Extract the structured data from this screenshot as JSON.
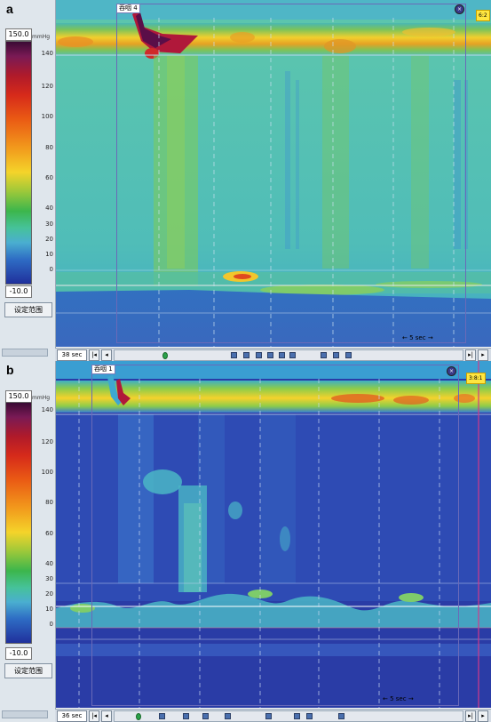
{
  "panels": [
    {
      "letter": "a",
      "scale": {
        "max": "150.0",
        "min": "-10.0",
        "unit": "mmHg",
        "ticks": [
          "140",
          "120",
          "100",
          "80",
          "60",
          "40",
          "30",
          "20",
          "10",
          "0"
        ]
      },
      "range_button": "设定范围",
      "record_label": "吞咽 4",
      "time_marker": "6:2",
      "scale_bar": "5 sec",
      "nav": {
        "interval": "38 sec",
        "events": 10
      }
    },
    {
      "letter": "b",
      "scale": {
        "max": "150.0",
        "min": "-10.0",
        "unit": "mmHg",
        "ticks": [
          "140",
          "120",
          "100",
          "80",
          "60",
          "40",
          "30",
          "20",
          "10",
          "0"
        ]
      },
      "range_button": "设定范围",
      "record_label": "吞咽 1",
      "time_marker": "3:8:1",
      "scale_bar": "5 sec",
      "nav": {
        "interval": "36 sec",
        "events": 9
      }
    }
  ]
}
